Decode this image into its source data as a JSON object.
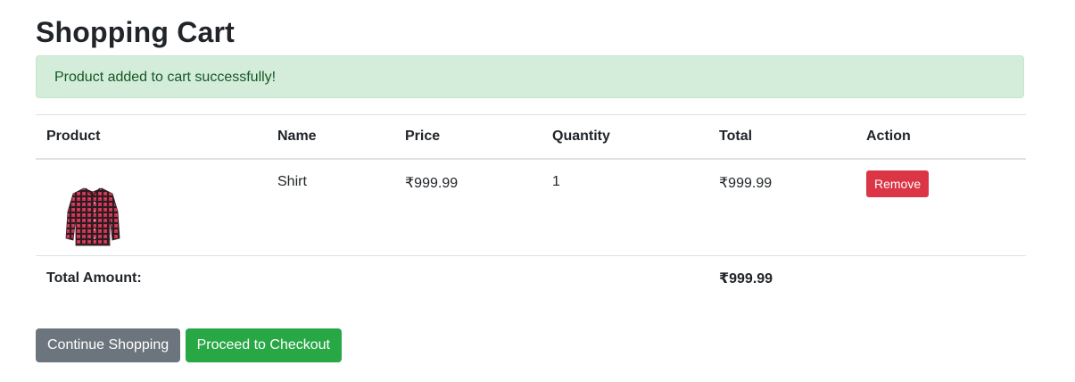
{
  "page": {
    "title": "Shopping Cart"
  },
  "alert": {
    "message": "Product added to cart successfully!"
  },
  "table": {
    "headers": {
      "product": "Product",
      "name": "Name",
      "price": "Price",
      "quantity": "Quantity",
      "total": "Total",
      "action": "Action"
    },
    "rows": [
      {
        "image_icon": "plaid-shirt-image",
        "name": "Shirt",
        "price": "₹999.99",
        "quantity": "1",
        "total": "₹999.99",
        "action_label": "Remove"
      }
    ],
    "summary": {
      "label": "Total Amount:",
      "amount": "₹999.99"
    }
  },
  "actions": {
    "continue_label": "Continue Shopping",
    "checkout_label": "Proceed to Checkout"
  },
  "colors": {
    "alert_bg": "#d4edda",
    "alert_text": "#155724",
    "danger": "#dc3545",
    "secondary": "#6c757d",
    "success": "#28a745"
  }
}
